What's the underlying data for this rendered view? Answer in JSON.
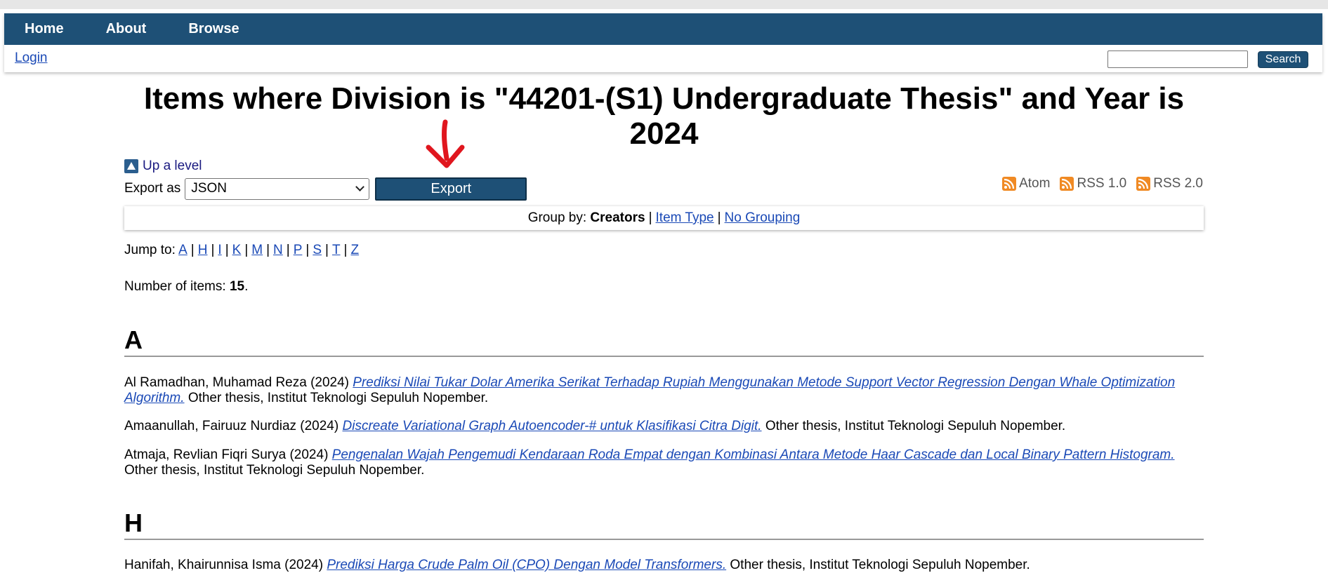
{
  "nav": {
    "items": [
      {
        "label": "Home"
      },
      {
        "label": "About"
      },
      {
        "label": "Browse"
      }
    ],
    "login_label": "Login",
    "search_value": "",
    "search_button": "Search"
  },
  "title": "Items where Division is \"44201-(S1) Undergraduate Thesis\" and Year is 2024",
  "up_level": "Up a level",
  "export": {
    "label": "Export as",
    "selected": "JSON",
    "button": "Export"
  },
  "feeds": {
    "atom": "Atom",
    "rss1": "RSS 1.0",
    "rss2": "RSS 2.0"
  },
  "groupby": {
    "label": "Group by:",
    "current": "Creators",
    "item_type": "Item Type",
    "no_grouping": "No Grouping",
    "sep": "|"
  },
  "jumpto": {
    "label": "Jump to:",
    "letters": [
      "A",
      "H",
      "I",
      "K",
      "M",
      "N",
      "P",
      "S",
      "T",
      "Z"
    ]
  },
  "count": {
    "label": "Number of items:",
    "value": "15",
    "suffix": "."
  },
  "sections": [
    {
      "heading": "A",
      "entries": [
        {
          "author": "Al Ramadhan, Muhamad Reza (2024)",
          "title": "Prediksi Nilai Tukar Dolar Amerika Serikat Terhadap Rupiah Menggunakan Metode Support Vector Regression Dengan Whale Optimization Algorithm.",
          "rest": "Other thesis, Institut Teknologi Sepuluh Nopember."
        },
        {
          "author": "Amaanullah, Fairuuz Nurdiaz (2024)",
          "title": "Discreate Variational Graph Autoencoder-# untuk Klasifikasi Citra Digit.",
          "rest": "Other thesis, Institut Teknologi Sepuluh Nopember."
        },
        {
          "author": "Atmaja, Revlian Fiqri Surya (2024)",
          "title": "Pengenalan Wajah Pengemudi Kendaraan Roda Empat dengan Kombinasi Antara Metode Haar Cascade dan Local Binary Pattern Histogram.",
          "rest": "Other thesis, Institut Teknologi Sepuluh Nopember."
        }
      ]
    },
    {
      "heading": "H",
      "entries": [
        {
          "author": "Hanifah, Khairunnisa Isma (2024)",
          "title": "Prediksi Harga Crude Palm Oil (CPO) Dengan Model Transformers.",
          "rest": "Other thesis, Institut Teknologi Sepuluh Nopember."
        }
      ]
    }
  ],
  "colors": {
    "nav_bg": "#1e5076",
    "link": "#1a49b6",
    "feed_icon": "#f08a24",
    "annotation_arrow": "#e0161e"
  }
}
